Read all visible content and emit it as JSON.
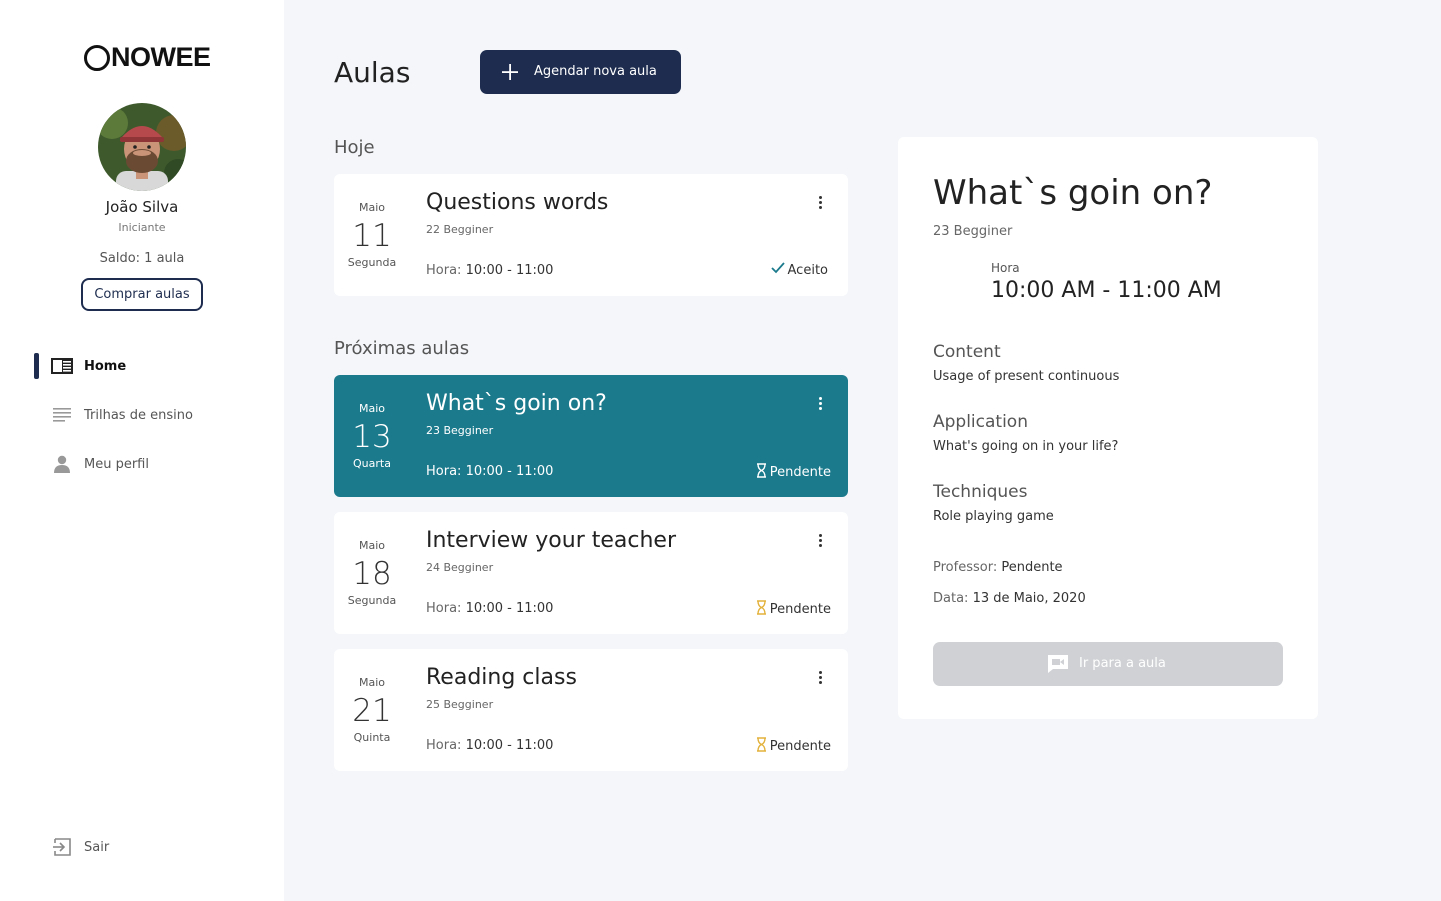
{
  "brand": {
    "name": "NOWEE"
  },
  "user": {
    "name": "João Silva",
    "level": "Iniciante",
    "balance": "Saldo: 1 aula",
    "buy_label": "Comprar aulas"
  },
  "nav": {
    "home": "Home",
    "tracks": "Trilhas de ensino",
    "profile": "Meu perfil",
    "logout": "Sair"
  },
  "header": {
    "title": "Aulas",
    "new_lesson_label": "Agendar nova aula"
  },
  "sections": {
    "today": "Hoje",
    "upcoming": "Próximas aulas"
  },
  "time_label": "Hora:",
  "lessons": [
    {
      "month": "Maio",
      "day": "11",
      "weekday": "Segunda",
      "title": "Questions words",
      "level": "22 Begginer",
      "time": "10:00 - 11:00",
      "status": "Aceito"
    },
    {
      "month": "Maio",
      "day": "13",
      "weekday": "Quarta",
      "title": "What`s goin on?",
      "level": "23 Begginer",
      "time": "10:00 - 11:00",
      "status": "Pendente"
    },
    {
      "month": "Maio",
      "day": "18",
      "weekday": "Segunda",
      "title": "Interview your teacher",
      "level": "24 Begginer",
      "time": "10:00 - 11:00",
      "status": "Pendente"
    },
    {
      "month": "Maio",
      "day": "21",
      "weekday": "Quinta",
      "title": "Reading class",
      "level": "25 Begginer",
      "time": "10:00 - 11:00",
      "status": "Pendente"
    }
  ],
  "detail": {
    "title": "What`s goin on?",
    "level": "23 Begginer",
    "hour_label": "Hora",
    "hour": "10:00 AM - 11:00 AM",
    "content_label": "Content",
    "content": "Usage of present continuous",
    "application_label": "Application",
    "application": "What's going on in your life?",
    "techniques_label": "Techniques",
    "techniques": "Role playing game",
    "teacher_label": "Professor:",
    "teacher": "Pendente",
    "date_label": "Data:",
    "date": "13 de Maio, 2020",
    "go_label": "Ir para a aula"
  },
  "colors": {
    "primary": "#1e2d4f",
    "selected_card": "#1b7a8c",
    "accepted": "#1b7a8c",
    "pending": "#e3b23c",
    "disabled_button": "#cfd1d4"
  },
  "icons": {
    "home": "home-icon",
    "tracks": "list-icon",
    "profile": "person-icon",
    "logout": "logout-icon",
    "accepted": "check-icon",
    "pending": "hourglass-icon",
    "menu": "more-vert-icon",
    "go": "video-chat-icon",
    "new": "plus-icon"
  }
}
